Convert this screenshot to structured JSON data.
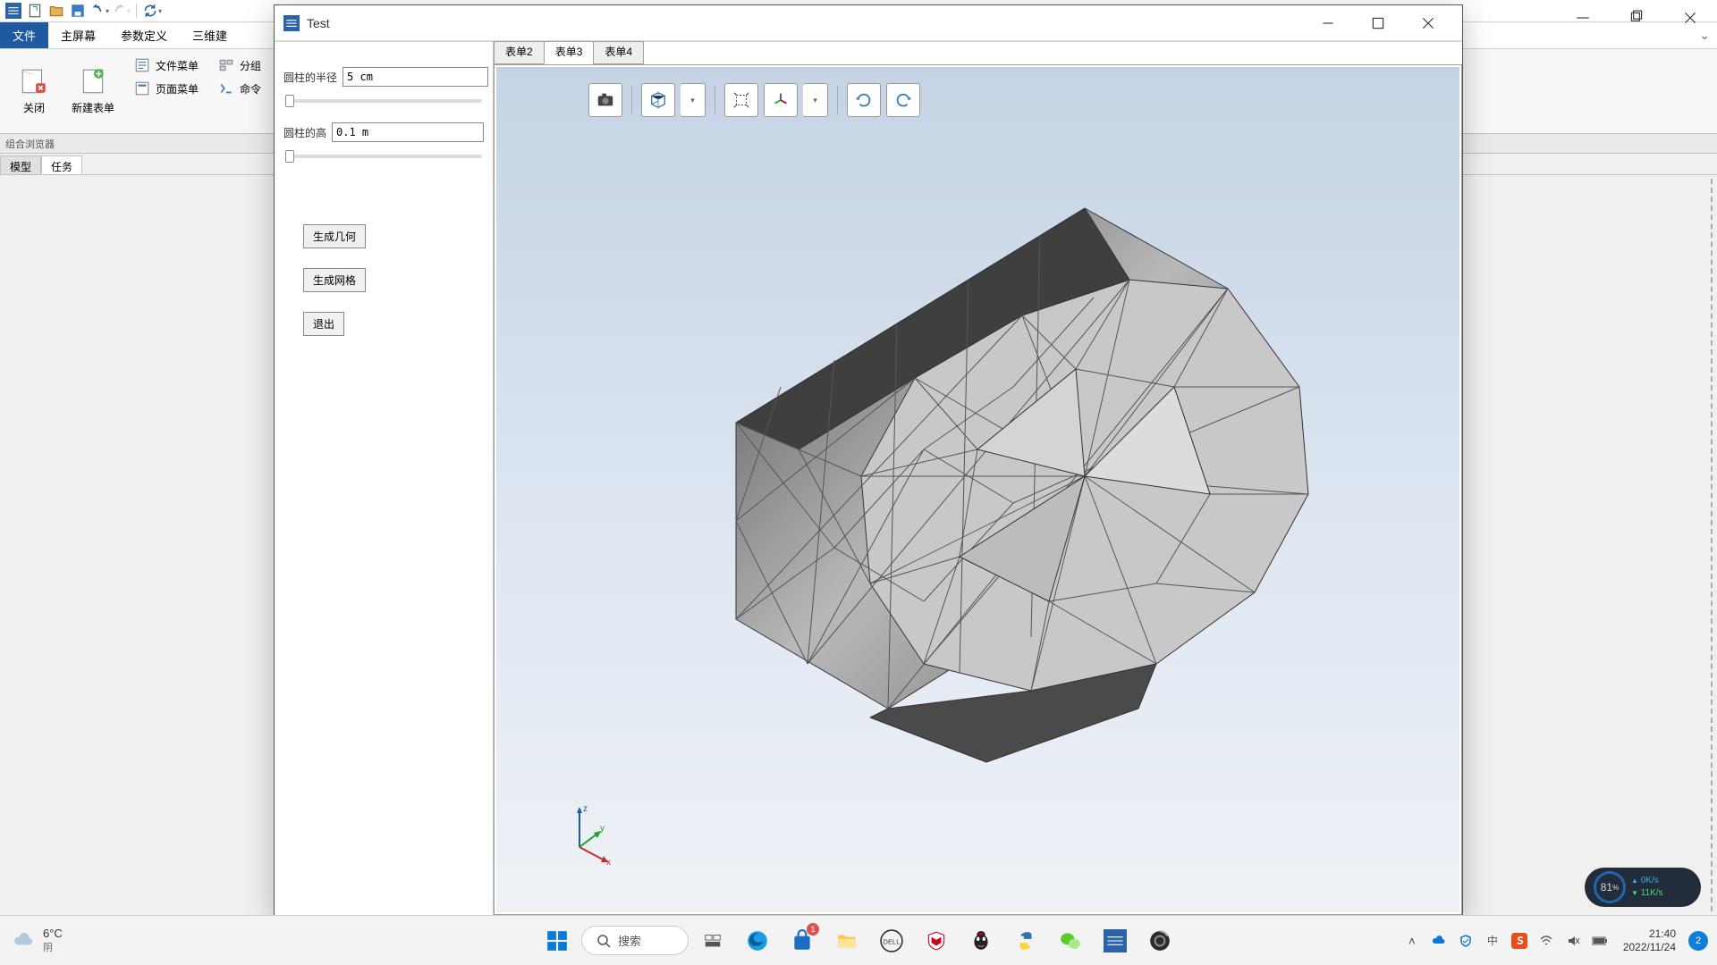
{
  "qat": {
    "icons": [
      "app-icon",
      "new-icon",
      "open-icon",
      "save-icon",
      "undo-icon",
      "redo-icon",
      "refresh-icon"
    ]
  },
  "ribbon": {
    "tabs": [
      "文件",
      "主屏幕",
      "参数定义",
      "三维建"
    ],
    "active": 0,
    "groups": {
      "close": "关闭",
      "newForm": "新建表单",
      "fileMenu": "文件菜单",
      "pageMenu": "页面菜单",
      "classify": "分组",
      "cmd": "命令"
    }
  },
  "subheader": "组合浏览器",
  "leftTabs": {
    "model": "模型",
    "task": "任务",
    "active": 1
  },
  "testWindow": {
    "title": "Test",
    "tabs": [
      "表单2",
      "表单3",
      "表单4"
    ],
    "activeTab": 1,
    "params": {
      "radiusLabel": "圆柱的半径",
      "radiusValue": "5 cm",
      "heightLabel": "圆柱的高",
      "heightValue": "0.1 m"
    },
    "buttons": {
      "genGeom": "生成几何",
      "genMesh": "生成网格",
      "exit": "退出"
    },
    "axes": {
      "x": "x",
      "y": "y",
      "z": "z"
    }
  },
  "weather": {
    "temp": "6°C",
    "cond": "阴"
  },
  "search": {
    "placeholder": "搜索"
  },
  "tray": {
    "time": "21:40",
    "date": "2022/11/24",
    "notif": "2"
  },
  "monitor": {
    "pct": "81",
    "unit": "%",
    "up": "0K/s",
    "down": "11K/s"
  }
}
